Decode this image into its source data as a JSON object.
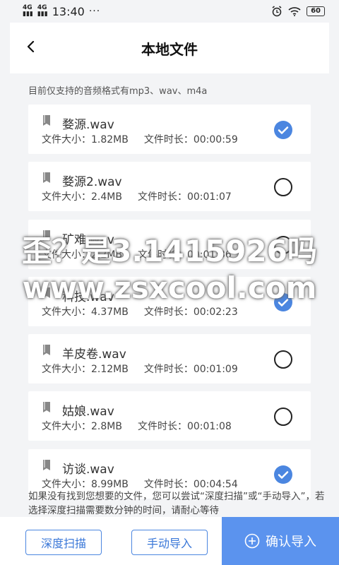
{
  "status_bar": {
    "net1": "4G",
    "net2": "4G",
    "time": "13:40",
    "dots": "···",
    "battery": "60"
  },
  "header": {
    "title": "本地文件"
  },
  "hint": "目前仅支持的音频格式有mp3、wav、m4a",
  "labels": {
    "size": "文件大小：",
    "duration": "文件时长："
  },
  "files": [
    {
      "name": "婺源.wav",
      "size": "1.82MB",
      "duration": "00:00:59",
      "selected": true
    },
    {
      "name": "婺源2.wav",
      "size": "2.4MB",
      "duration": "00:01:07",
      "selected": false
    },
    {
      "name": "矿难.wav",
      "size": "2.2MB",
      "duration": "00:01:36",
      "selected": false
    },
    {
      "name": "科技.wav",
      "size": "4.37MB",
      "duration": "00:02:23",
      "selected": true
    },
    {
      "name": "羊皮卷.wav",
      "size": "2.12MB",
      "duration": "00:01:09",
      "selected": false
    },
    {
      "name": "姑娘.wav",
      "size": "2.8MB",
      "duration": "00:01:08",
      "selected": false
    },
    {
      "name": "访谈.wav",
      "size": "8.99MB",
      "duration": "00:04:54",
      "selected": true
    }
  ],
  "watermark": {
    "line1": "歪？是3.1415926吗",
    "line2": "www.zsxcool.com"
  },
  "note": "如果没有找到您想要的文件，您可以尝试“深度扫描”或“手动导入”，若选择深度扫描需要数分钟的时间，请耐心等待",
  "buttons": {
    "scan": "深度扫描",
    "manual": "手动导入",
    "confirm": "确认导入"
  },
  "colors": {
    "accent": "#4b86e0",
    "confirm_bg": "#5b93ee"
  }
}
